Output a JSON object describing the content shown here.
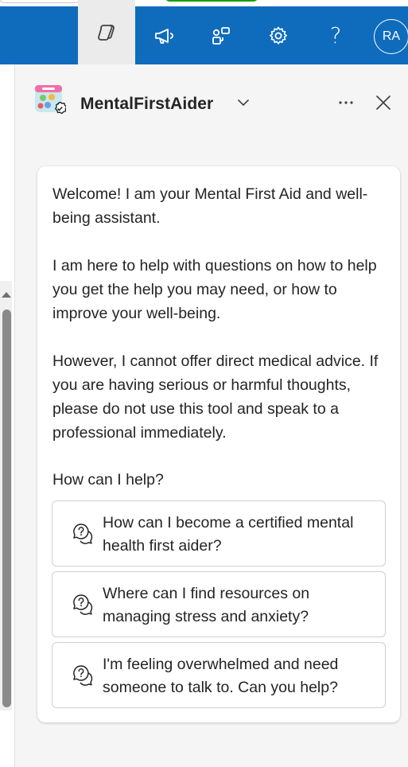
{
  "topbar": {
    "copilot_icon": "copilot-icon",
    "icons": [
      "megaphone-icon",
      "apps-icon",
      "gear-icon",
      "help-icon"
    ],
    "help_glyph": "?",
    "avatar_initials": "RA",
    "accent": "#0f6cbd"
  },
  "pane": {
    "app_name": "MentalFirstAider",
    "logo_icon": "app-logo-icon",
    "more_label": "More options",
    "close_label": "Close"
  },
  "card": {
    "paragraphs": [
      "Welcome! I am your Mental First Aid and well-being assistant.",
      "I am here to help with questions on how to help you get the help you may need, or how to improve your well-being.",
      "However, I cannot offer direct medical advice. If you are having serious or harmful thoughts, please do not use this tool and speak to a professional immediately."
    ],
    "prompt": "How can I help?",
    "suggestions": [
      {
        "text": "How can I become a certified mental health first aider?",
        "icon": "chat-help-icon"
      },
      {
        "text": "Where can I find resources on managing stress and anxiety?",
        "icon": "chat-help-icon"
      },
      {
        "text": "I'm feeling overwhelmed and need someone to talk to. Can you help?",
        "icon": "chat-help-icon"
      }
    ]
  }
}
